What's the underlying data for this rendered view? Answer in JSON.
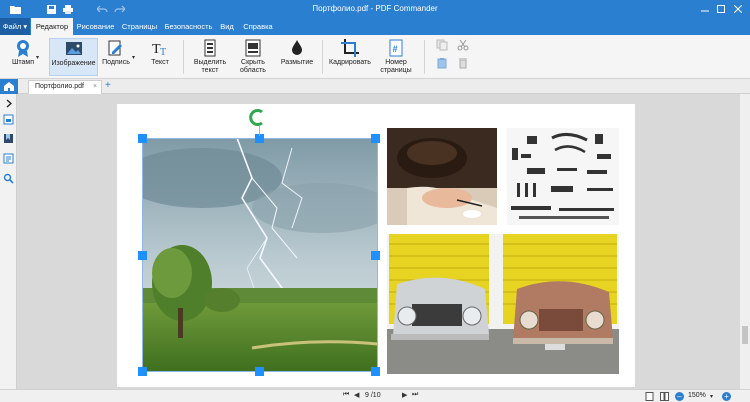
{
  "window": {
    "title": "Портфолио.pdf - PDF Commander"
  },
  "menu": {
    "file": "Файл",
    "tabs": [
      "Редактор",
      "Рисование",
      "Страницы",
      "Безопасность",
      "Вид",
      "Справка"
    ]
  },
  "ribbon": {
    "stamp": "Штамп",
    "image": "Изображение",
    "signature": "Подпись",
    "text": "Текст",
    "highlight": [
      "Выделить",
      "текст"
    ],
    "hide_area": [
      "Скрыть",
      "область"
    ],
    "blur": "Размытие",
    "crop": "Кадрировать",
    "page_number": [
      "Номер",
      "страницы"
    ]
  },
  "document_tab": {
    "label": "Портфолио.pdf",
    "close": "×",
    "add": "+"
  },
  "status": {
    "current_page": "9",
    "total_pages": "/10",
    "zoom": "150%"
  },
  "colors": {
    "accent": "#2b7fd1",
    "selection_handle": "#1e90ff",
    "rotate_handle": "#2fa84f"
  }
}
